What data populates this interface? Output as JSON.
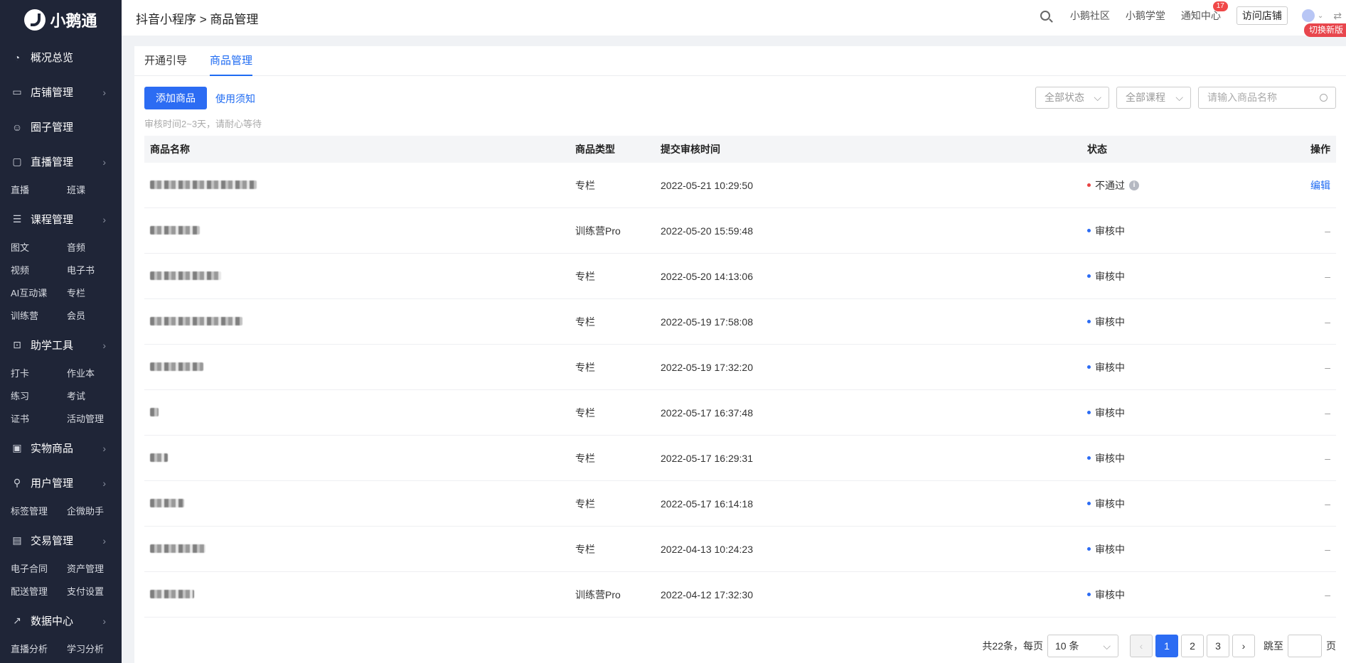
{
  "brand": {
    "name": "小鹅通"
  },
  "sidebar": {
    "groups": [
      {
        "label": "概况总览",
        "icon": "dashboard-icon",
        "has_children": false,
        "subs": []
      },
      {
        "label": "店铺管理",
        "icon": "store-icon",
        "has_children": true,
        "subs": []
      },
      {
        "label": "圈子管理",
        "icon": "group-icon",
        "has_children": false,
        "subs": []
      },
      {
        "label": "直播管理",
        "icon": "video-icon",
        "has_children": true,
        "subs": [
          "直播",
          "班课"
        ]
      },
      {
        "label": "课程管理",
        "icon": "course-icon",
        "has_children": true,
        "subs": [
          "图文",
          "音频",
          "视频",
          "电子书",
          "AI互动课",
          "专栏",
          "训练营",
          "会员"
        ]
      },
      {
        "label": "助学工具",
        "icon": "toolbox-icon",
        "has_children": true,
        "subs": [
          "打卡",
          "作业本",
          "练习",
          "考试",
          "证书",
          "活动管理"
        ]
      },
      {
        "label": "实物商品",
        "icon": "bag-icon",
        "has_children": true,
        "subs": []
      },
      {
        "label": "用户管理",
        "icon": "user-icon",
        "has_children": true,
        "subs": [
          "标签管理",
          "企微助手"
        ]
      },
      {
        "label": "交易管理",
        "icon": "card-icon",
        "has_children": true,
        "subs": [
          "电子合同",
          "资产管理",
          "配送管理",
          "支付设置"
        ]
      },
      {
        "label": "数据中心",
        "icon": "chart-icon",
        "has_children": true,
        "subs": [
          "直播分析",
          "学习分析"
        ]
      }
    ]
  },
  "header": {
    "breadcrumb": "抖音小程序 > 商品管理",
    "links": {
      "community": "小鹅社区",
      "school": "小鹅学堂",
      "notify": "通知中心"
    },
    "notify_count": "17",
    "visit_store": "访问店铺",
    "switch_new": "切换新版"
  },
  "tabs": [
    {
      "label": "开通引导",
      "active": false
    },
    {
      "label": "商品管理",
      "active": true
    }
  ],
  "toolbar": {
    "add_button": "添加商品",
    "notice_link": "使用须知",
    "status_filter": "全部状态",
    "course_filter": "全部课程",
    "search_placeholder": "请输入商品名称",
    "hint": "审核时间2~3天，请耐心等待"
  },
  "table": {
    "headers": {
      "name": "商品名称",
      "type": "商品类型",
      "time": "提交审核时间",
      "status": "状态",
      "op": "操作"
    },
    "rows": [
      {
        "type": "专栏",
        "time": "2022-05-21 10:29:50",
        "status": "不通过",
        "status_color": "#e84343",
        "op": "编辑",
        "info": true
      },
      {
        "type": "训练营Pro",
        "time": "2022-05-20 15:59:48",
        "status": "审核中",
        "status_color": "#2c6cf3",
        "op": "–"
      },
      {
        "type": "专栏",
        "time": "2022-05-20 14:13:06",
        "status": "审核中",
        "status_color": "#2c6cf3",
        "op": "–"
      },
      {
        "type": "专栏",
        "time": "2022-05-19 17:58:08",
        "status": "审核中",
        "status_color": "#2c6cf3",
        "op": "–"
      },
      {
        "type": "专栏",
        "time": "2022-05-19 17:32:20",
        "status": "审核中",
        "status_color": "#2c6cf3",
        "op": "–"
      },
      {
        "type": "专栏",
        "time": "2022-05-17 16:37:48",
        "status": "审核中",
        "status_color": "#2c6cf3",
        "op": "–"
      },
      {
        "type": "专栏",
        "time": "2022-05-17 16:29:31",
        "status": "审核中",
        "status_color": "#2c6cf3",
        "op": "–"
      },
      {
        "type": "专栏",
        "time": "2022-05-17 16:14:18",
        "status": "审核中",
        "status_color": "#2c6cf3",
        "op": "–"
      },
      {
        "type": "专栏",
        "time": "2022-04-13 10:24:23",
        "status": "审核中",
        "status_color": "#2c6cf3",
        "op": "–"
      },
      {
        "type": "训练营Pro",
        "time": "2022-04-12 17:32:30",
        "status": "审核中",
        "status_color": "#2c6cf3",
        "op": "–"
      }
    ]
  },
  "pagination": {
    "total": "共22条，每页",
    "page_size": "10 条",
    "pages": [
      "1",
      "2",
      "3"
    ],
    "current": "1",
    "jump_label": "跳至",
    "page_suffix": "页"
  }
}
